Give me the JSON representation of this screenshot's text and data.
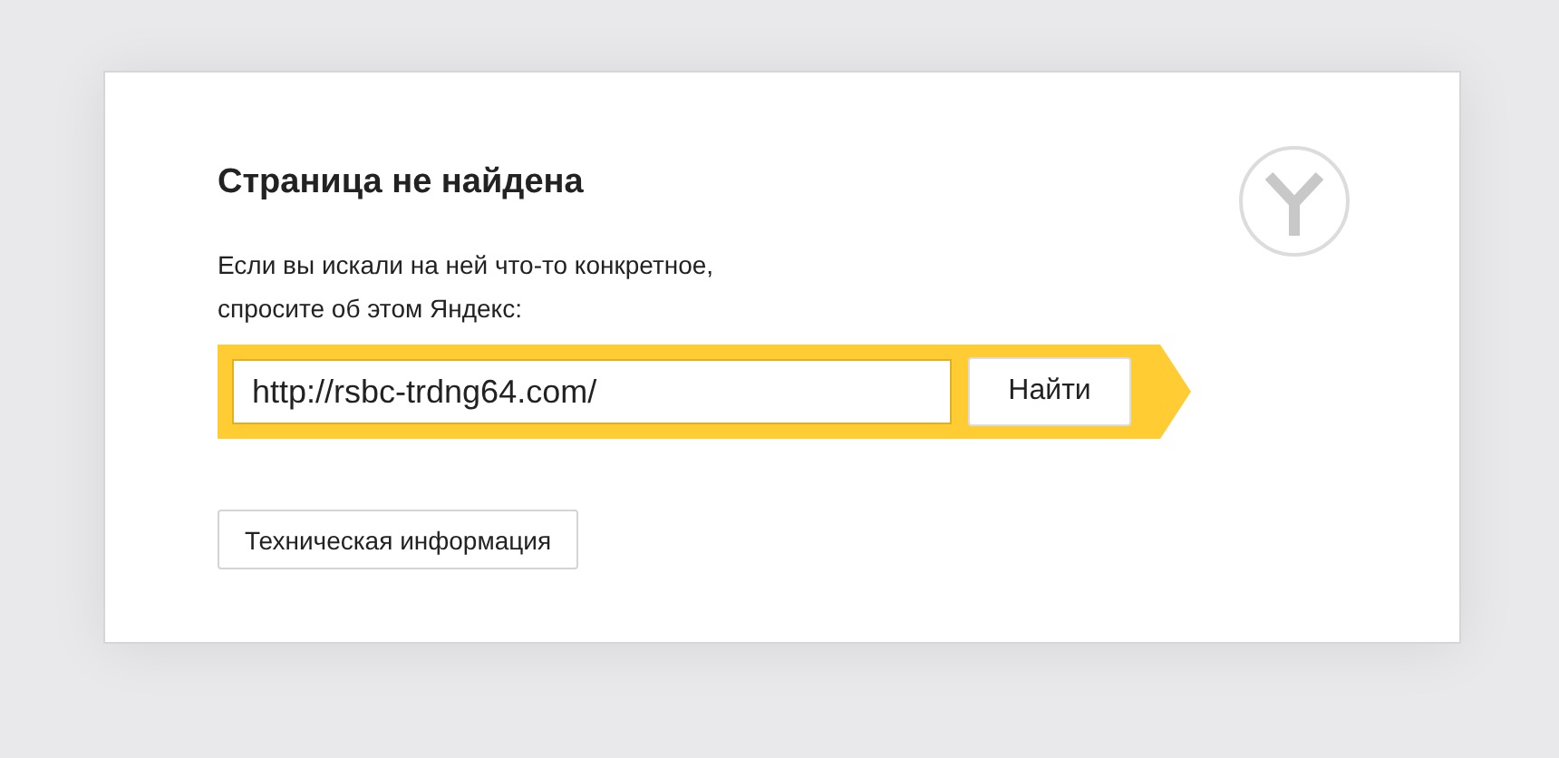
{
  "error": {
    "title": "Страница не найдена",
    "message": "Если вы искали на ней что-то конкретное,\nспросите об этом Яндекс:"
  },
  "search": {
    "value": "http://rsbc-trdng64.com/",
    "button": "Найти"
  },
  "details_button": "Техническая информация"
}
